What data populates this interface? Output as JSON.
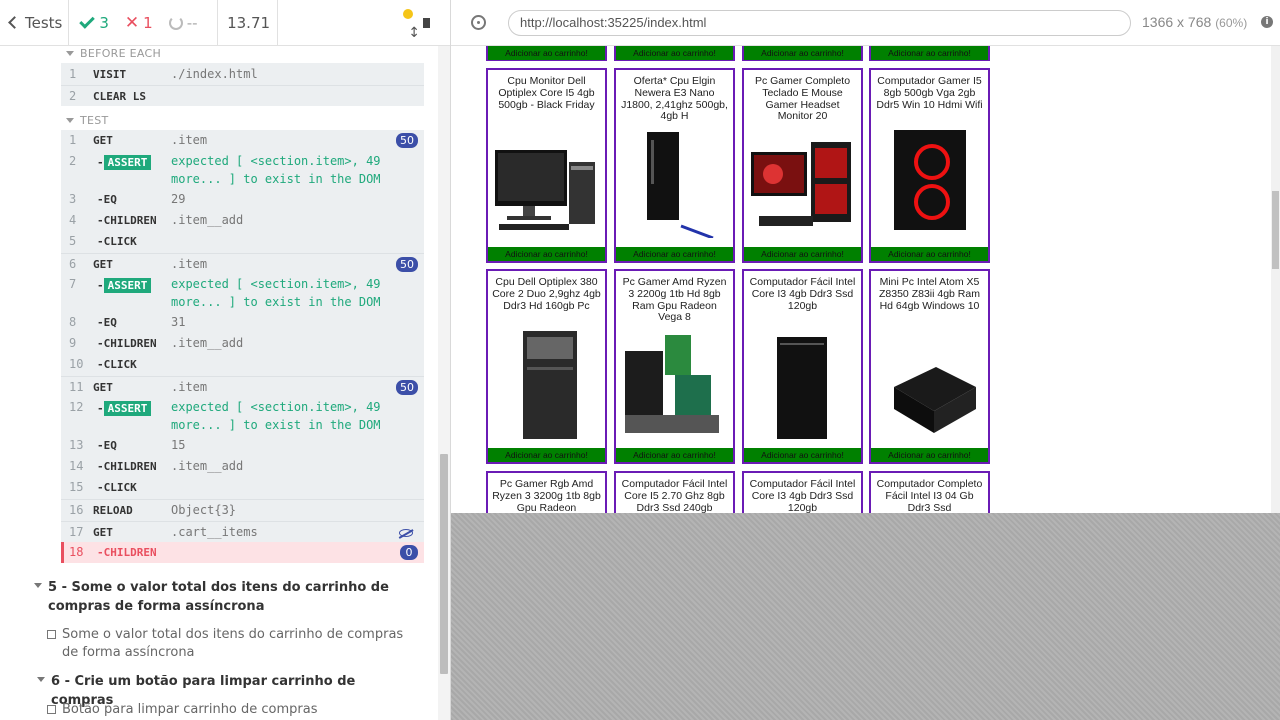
{
  "topbar": {
    "tests_label": "Tests",
    "passed": "3",
    "failed": "1",
    "pending": "--",
    "duration": "13.71"
  },
  "commands": {
    "before_each_label": "BEFORE EACH",
    "test_label": "TEST",
    "before_each": [
      {
        "num": "1",
        "name": "VISIT",
        "msg": "./index.html"
      },
      {
        "num": "2",
        "name": "CLEAR LS",
        "msg": ""
      }
    ],
    "rows": [
      {
        "num": "1",
        "name": "GET",
        "msg": ".item",
        "badge": "50"
      },
      {
        "num": "2",
        "name": "ASSERT",
        "line1": "expected [ <section.item>, 49",
        "line2": "more... ] to exist in the DOM"
      },
      {
        "num": "3",
        "name": "EQ",
        "msg": "29"
      },
      {
        "num": "4",
        "name": "CHILDREN",
        "msg": ".item__add"
      },
      {
        "num": "5",
        "name": "CLICK",
        "msg": ""
      },
      {
        "num": "6",
        "name": "GET",
        "msg": ".item",
        "badge": "50"
      },
      {
        "num": "7",
        "name": "ASSERT",
        "line1": "expected [ <section.item>, 49",
        "line2": "more... ] to exist in the DOM"
      },
      {
        "num": "8",
        "name": "EQ",
        "msg": "31"
      },
      {
        "num": "9",
        "name": "CHILDREN",
        "msg": ".item__add"
      },
      {
        "num": "10",
        "name": "CLICK",
        "msg": ""
      },
      {
        "num": "11",
        "name": "GET",
        "msg": ".item",
        "badge": "50"
      },
      {
        "num": "12",
        "name": "ASSERT",
        "line1": "expected [ <section.item>, 49",
        "line2": "more... ] to exist in the DOM"
      },
      {
        "num": "13",
        "name": "EQ",
        "msg": "15"
      },
      {
        "num": "14",
        "name": "CHILDREN",
        "msg": ".item__add"
      },
      {
        "num": "15",
        "name": "CLICK",
        "msg": ""
      },
      {
        "num": "16",
        "name": "RELOAD",
        "msg": "Object{3}"
      },
      {
        "num": "17",
        "name": "GET",
        "msg": ".cart__items"
      },
      {
        "num": "18",
        "name": "CHILDREN",
        "msg": "",
        "badge": "0"
      }
    ]
  },
  "suites": [
    {
      "title": "5 - Some o valor total dos itens do carrinho de compras de forma assíncrona",
      "test": "Some o valor total dos itens do carrinho de compras de forma assíncrona"
    },
    {
      "title": "6 - Crie um botão para limpar carrinho de compras",
      "test": "Botão para limpar carrinho de compras"
    }
  ],
  "aut": {
    "url": "http://localhost:35225/index.html",
    "viewport": "1366 x 768",
    "scale": "(60%)",
    "add_button": "Adicionar ao carrinho!",
    "products_row1": [
      "Cpu Monitor Dell Optiplex Core I5 4gb 500gb - Black Friday",
      "Oferta* Cpu Elgin Newera E3 Nano J1800, 2,41ghz 500gb, 4gb H",
      "Pc Gamer Completo Teclado E Mouse Gamer Headset Monitor 20",
      "Computador Gamer I5 8gb 500gb Vga 2gb Ddr5 Win 10 Hdmi Wifi"
    ],
    "products_row2": [
      "Cpu Dell Optiplex 380 Core 2 Duo 2,9ghz 4gb Ddr3 Hd 160gb Pc",
      "Pc Gamer Amd Ryzen 3 2200g 1tb Hd 8gb Ram Gpu Radeon Vega 8",
      "Computador Fácil Intel Core I3 4gb Ddr3 Ssd 120gb",
      "Mini Pc Intel Atom X5 Z8350 Z83ii 4gb Ram Hd 64gb Windows 10"
    ],
    "products_row3": [
      "Pc Gamer Rgb Amd Ryzen 3 3200g 1tb 8gb Gpu Radeon",
      "Computador Fácil Intel Core I5 2.70 Ghz 8gb Ddr3 Ssd 240gb",
      "Computador Fácil Intel Core I3 4gb Ddr3 Ssd 120gb",
      "Computador Completo Fácil Intel I3 04 Gb Ddr3 Ssd"
    ]
  }
}
